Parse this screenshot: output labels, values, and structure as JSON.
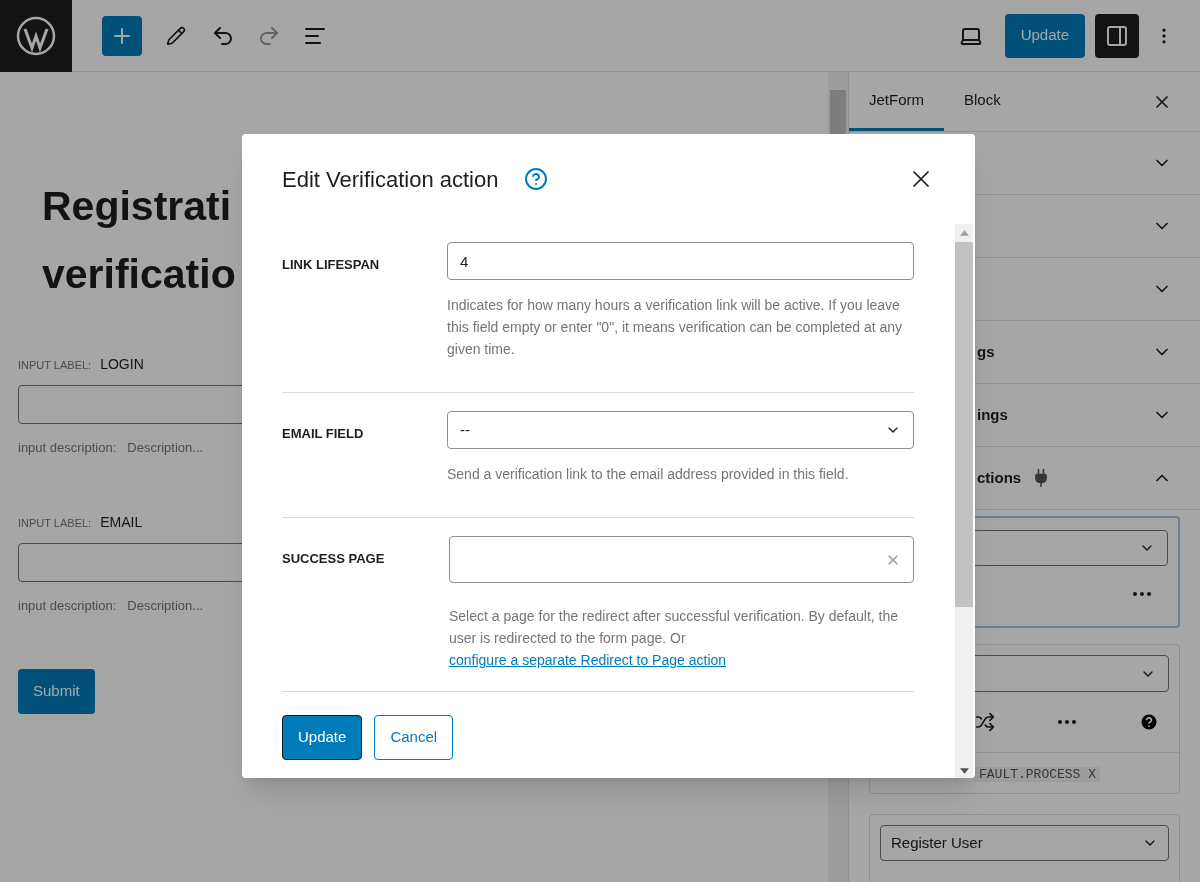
{
  "toolbar": {
    "update_button": "Update"
  },
  "editor": {
    "title_lines": [
      "Registrati",
      "verificatio"
    ],
    "fields": [
      {
        "label_prefix": "INPUT LABEL:",
        "label": "LOGIN",
        "description_prefix": "input description:",
        "description_placeholder": "Description..."
      },
      {
        "label_prefix": "INPUT LABEL:",
        "label": "EMAIL",
        "description_prefix": "input description:",
        "description_placeholder": "Description..."
      }
    ],
    "submit_button": "Submit"
  },
  "sidebar": {
    "tabs": [
      {
        "label": "JetForm",
        "selected": true
      },
      {
        "label": "Block",
        "selected": false
      }
    ],
    "panels": [
      {
        "expanded": false
      },
      {
        "expanded": false
      },
      {
        "expanded": false
      },
      {
        "title": "gs",
        "expanded": false
      },
      {
        "title": "ings",
        "expanded": false
      },
      {
        "title": "ctions",
        "expanded": true
      }
    ],
    "action_cards": [
      {
        "kind": "menu",
        "selected": true
      },
      {
        "kind": "tools",
        "selected": false,
        "tag": "FAULT.PROCESS X"
      },
      {
        "kind": "select",
        "selected": false,
        "value": "Register User"
      }
    ]
  },
  "modal": {
    "title": "Edit Verification action",
    "rows": [
      {
        "kind": "text",
        "label": "LINK LIFESPAN",
        "value": "4",
        "help": "Indicates for how many hours a verification link will be active. If you leave this field empty or enter \"0\", it means verification can be completed at any given time."
      },
      {
        "kind": "select",
        "label": "EMAIL FIELD",
        "value": "--",
        "help": "Send a verification link to the email address provided in this field."
      },
      {
        "kind": "search",
        "label": "SUCCESS PAGE",
        "help": "Select a page for the redirect after successful verification. By default, the user is redirected to the form page. Or",
        "link": "configure a separate Redirect to Page action"
      }
    ],
    "buttons": [
      {
        "label": "Update",
        "primary": true
      },
      {
        "label": "Cancel",
        "primary": false
      }
    ]
  }
}
